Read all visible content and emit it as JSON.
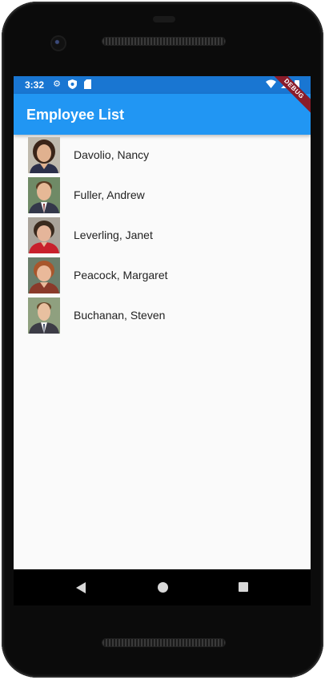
{
  "status_bar": {
    "time": "3:32",
    "icons": [
      "settings-icon",
      "shield-icon",
      "sd-card-icon",
      "wifi-icon",
      "signal-icon",
      "battery-icon"
    ],
    "color": "#1976d2"
  },
  "app_bar": {
    "title": "Employee List",
    "color": "#2196f3",
    "debug_banner": "DEBUG"
  },
  "employees": [
    {
      "name": "Davolio, Nancy",
      "avatar": "photo-nancy"
    },
    {
      "name": "Fuller, Andrew",
      "avatar": "photo-andrew"
    },
    {
      "name": "Leverling, Janet",
      "avatar": "photo-janet"
    },
    {
      "name": "Peacock, Margaret",
      "avatar": "photo-margaret"
    },
    {
      "name": "Buchanan, Steven",
      "avatar": "photo-steven"
    }
  ],
  "nav_bar": {
    "buttons": [
      "back-icon",
      "home-icon",
      "recents-icon"
    ]
  }
}
